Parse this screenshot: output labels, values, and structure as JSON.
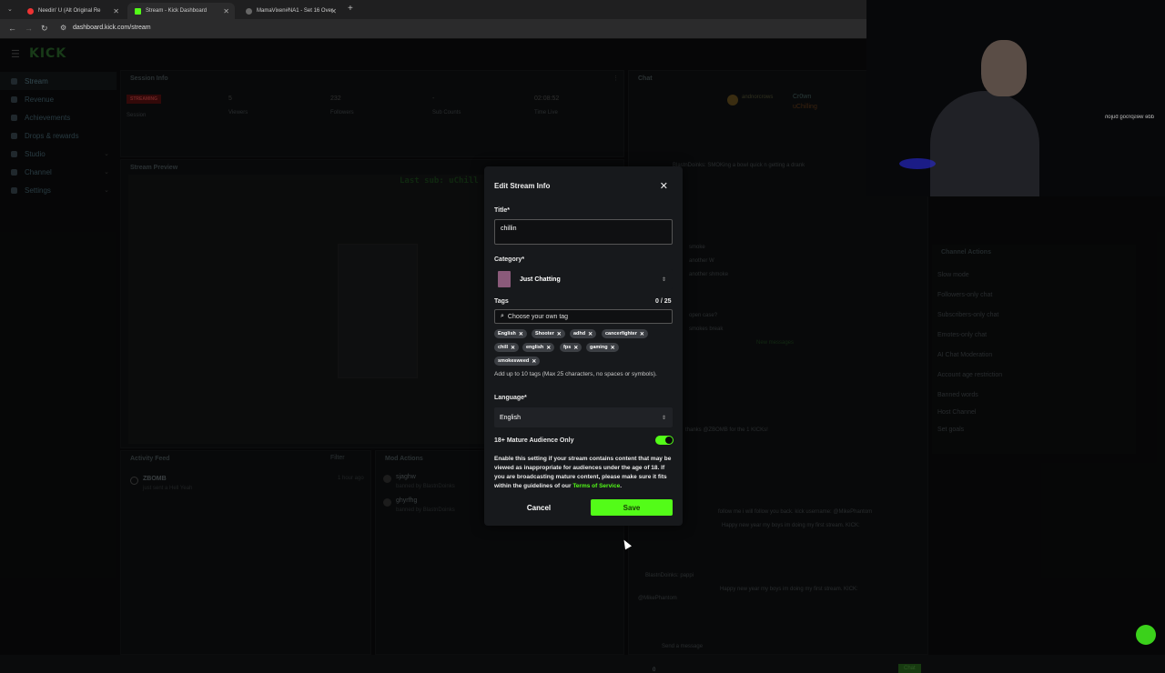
{
  "browser": {
    "tabs": [
      {
        "label": "Needin' U (Alt Original Re"
      },
      {
        "label": "Stream - Kick Dashboard"
      },
      {
        "label": "MamaVixen#NA1 - Set 16 Over"
      }
    ],
    "url": "dashboard.kick.com/stream"
  },
  "app": {
    "logo": "KICK",
    "sidebar": {
      "items": [
        {
          "label": "Stream"
        },
        {
          "label": "Revenue"
        },
        {
          "label": "Achievements"
        },
        {
          "label": "Drops & rewards"
        },
        {
          "label": "Studio"
        },
        {
          "label": "Channel"
        },
        {
          "label": "Settings"
        }
      ]
    },
    "session": {
      "title": "Session Info",
      "status": "STREAMING",
      "status_sub": "Session",
      "stats": [
        {
          "value": "5",
          "label": "Viewers"
        },
        {
          "value": "232",
          "label": "Followers"
        },
        {
          "value": "-",
          "label": "Sub Counts"
        },
        {
          "value": "02:08:52",
          "label": "Time Live"
        }
      ]
    },
    "preview_title": "Stream Preview",
    "activity_title": "Activity Feed",
    "activity_filter": "Filter",
    "activity_user": "ZBOMB",
    "activity_time": "1 hour ago",
    "activity_detail": "just sent a Hell Yeah",
    "mod_title": "Mod Actions",
    "mod_items": [
      {
        "user": "sjaghw",
        "detail": "banned by BlastnDoinks"
      },
      {
        "user": "ghyrfhg",
        "detail": "banned by BlastnDoinks"
      }
    ],
    "chat_title": "Chat",
    "chat_top_user": "andnorcrows",
    "chat_pinned": [
      "Cr0wn",
      "uChilling"
    ],
    "chat_lines": [
      "BlastnDoinks: SMOKing a bowl quick n getting a drank",
      "smoke",
      "another W",
      "another shmoke",
      "open case?",
      "smokes break",
      "thanks @ZBOMB for the 1 KICKs!",
      "follow me i will follow you back. kick username: @MikePhantom",
      "Happy new year my boys im doing my first stream. KICK:",
      "BlastnDoinks: pappi",
      "Happy new year my boys im doing my first stream. KICK:",
      "@MikePhantom"
    ],
    "new_messages": "New messages",
    "send_placeholder": "Send a message",
    "chat_button": "Chat",
    "chat_count": "0",
    "channel_actions": {
      "title": "Channel Actions",
      "items": [
        "Slow mode",
        "Followers-only chat",
        "Subscribers-only chat",
        "Emotes-only chat",
        "AI Chat Moderation",
        "Account age restriction",
        "Banned words",
        "Host Channel",
        "Set goals"
      ]
    },
    "preview_overlay_text": "Last sub: uChill"
  },
  "modal": {
    "title": "Edit Stream Info",
    "title_label": "Title*",
    "title_value": "chillin",
    "category_label": "Category*",
    "category_value": "Just Chatting",
    "tags_label": "Tags",
    "tags_count": "0 / 25",
    "tags_placeholder": "Choose your own tag",
    "tags": [
      "English",
      "Shooter",
      "adhd",
      "cancerfighter",
      "chill",
      "english",
      "fps",
      "gaming",
      "smokesweed"
    ],
    "tags_help": "Add up to 10 tags (Max 25 characters, no spaces or symbols).",
    "language_label": "Language*",
    "language_value": "English",
    "mature_label": "18+ Mature Audience Only",
    "mature_enabled": true,
    "mature_help_pre": "Enable this setting if your stream contains content that may be viewed as inappropriate for audiences under the age of 18. If you are broadcasting mature content, please make sure it fits within the guidelines of our ",
    "mature_help_link": "Terms of Service",
    "mature_help_post": ".",
    "cancel_label": "Cancel",
    "save_label": "Save"
  },
  "webcam": {
    "mirrored_text": "dde wesproog bujon"
  },
  "colors": {
    "accent": "#53fc18",
    "modal_bg": "#17191c",
    "page_bg": "#0b0c0d"
  }
}
